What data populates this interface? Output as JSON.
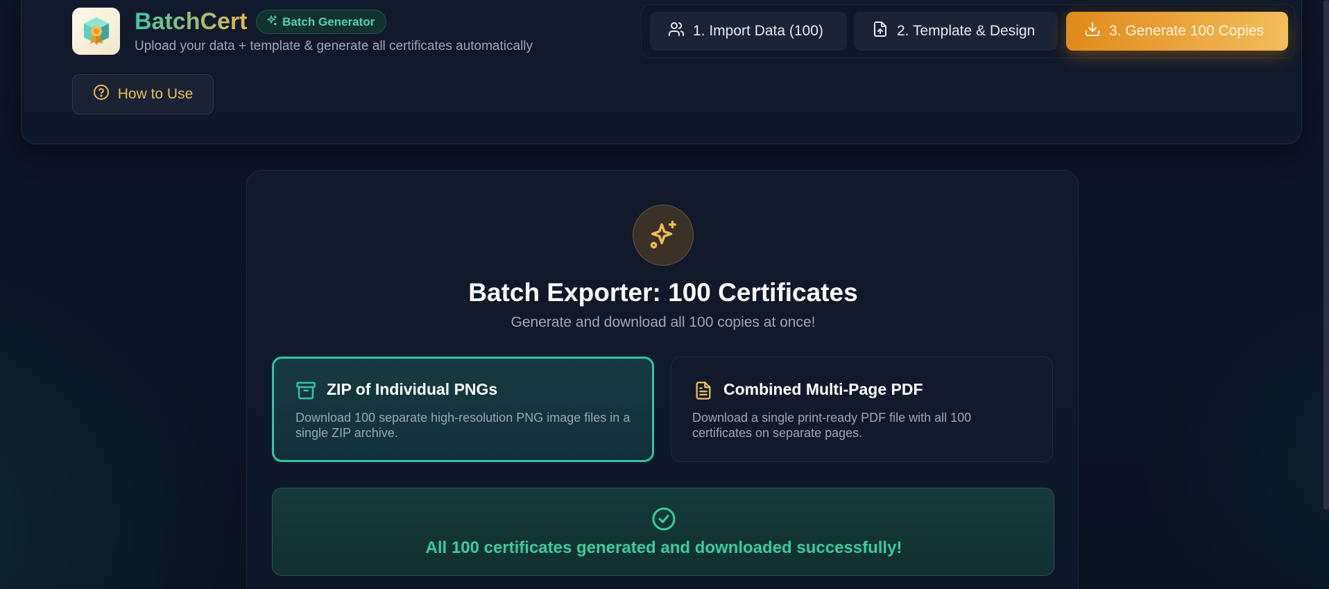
{
  "app": {
    "name": "BatchCert",
    "badge": "Batch Generator",
    "subtitle": "Upload your data + template & generate all certificates automatically",
    "how_to_use": "How to Use",
    "logo_icon": "certificate-box-icon"
  },
  "stepper": {
    "steps": [
      {
        "label": "1. Import Data (100)",
        "icon": "users-icon",
        "active": false
      },
      {
        "label": "2. Template & Design",
        "icon": "file-upload-icon",
        "active": false
      },
      {
        "label": "3. Generate 100 Copies",
        "icon": "download-icon",
        "active": true
      }
    ]
  },
  "exporter": {
    "icon": "sparkles-icon",
    "title": "Batch Exporter: 100 Certificates",
    "subtitle": "Generate and download all 100 copies at once!",
    "options": [
      {
        "title": "ZIP of Individual PNGs",
        "description": "Download 100 separate high-resolution PNG image files in a single ZIP archive.",
        "icon": "archive-icon",
        "selected": true
      },
      {
        "title": "Combined Multi-Page PDF",
        "description": "Download a single print-ready PDF file with all 100 certificates on separate pages.",
        "icon": "document-icon",
        "selected": false
      }
    ],
    "success": {
      "icon": "check-circle-icon",
      "message": "All 100 certificates generated and downloaded successfully!"
    }
  },
  "colors": {
    "accent_teal": "#2cc7a5",
    "accent_orange": "#e08a1a",
    "gold": "#f2bd52",
    "success_green": "#37cf9c",
    "background": "#0d1424"
  }
}
